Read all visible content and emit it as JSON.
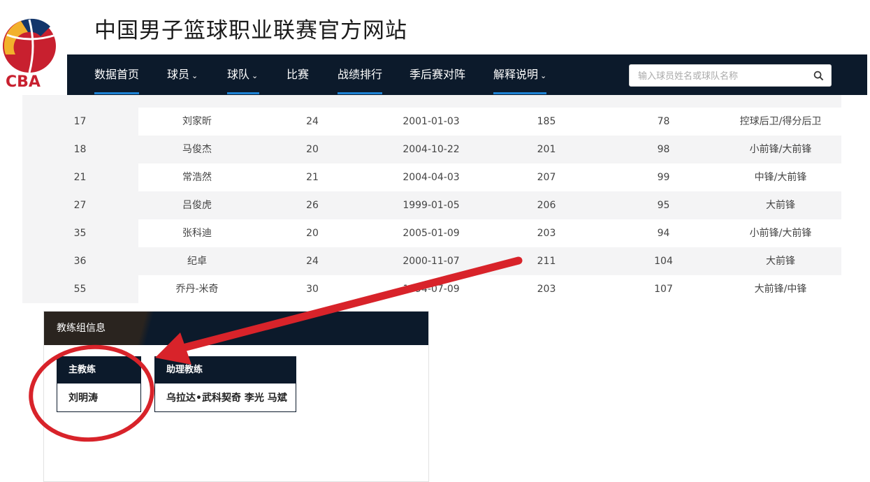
{
  "site": {
    "title": "中国男子篮球职业联赛官方网站",
    "logo_text": "CBA"
  },
  "nav": {
    "items": [
      {
        "label": "数据首页",
        "dropdown": false
      },
      {
        "label": "球员",
        "dropdown": true
      },
      {
        "label": "球队",
        "dropdown": true
      },
      {
        "label": "比赛",
        "dropdown": false
      },
      {
        "label": "战绩排行",
        "dropdown": false
      },
      {
        "label": "季后赛对阵",
        "dropdown": false
      },
      {
        "label": "解释说明",
        "dropdown": true
      }
    ],
    "chevron": "⌄"
  },
  "search": {
    "placeholder": "输入球员姓名或球队名称",
    "icon": "search-icon"
  },
  "roster": {
    "rows": [
      {
        "num": "17",
        "name": "刘家昕",
        "age": "24",
        "birth": "2001-01-03",
        "height": "185",
        "weight": "78",
        "position": "控球后卫/得分后卫"
      },
      {
        "num": "18",
        "name": "马俊杰",
        "age": "20",
        "birth": "2004-10-22",
        "height": "201",
        "weight": "98",
        "position": "小前锋/大前锋"
      },
      {
        "num": "21",
        "name": "常浩然",
        "age": "21",
        "birth": "2004-04-03",
        "height": "207",
        "weight": "99",
        "position": "中锋/大前锋"
      },
      {
        "num": "27",
        "name": "吕俊虎",
        "age": "26",
        "birth": "1999-01-05",
        "height": "206",
        "weight": "95",
        "position": "大前锋"
      },
      {
        "num": "35",
        "name": "张科迪",
        "age": "20",
        "birth": "2005-01-09",
        "height": "203",
        "weight": "94",
        "position": "小前锋/大前锋"
      },
      {
        "num": "36",
        "name": "纪卓",
        "age": "24",
        "birth": "2000-11-07",
        "height": "211",
        "weight": "104",
        "position": "大前锋"
      },
      {
        "num": "55",
        "name": "乔丹-米奇",
        "age": "30",
        "birth": "1994-07-09",
        "height": "203",
        "weight": "107",
        "position": "大前锋/中锋"
      }
    ]
  },
  "coaches": {
    "section_title": "教练组信息",
    "head_coach": {
      "label": "主教练",
      "names": "刘明涛"
    },
    "assistant_coaches": {
      "label": "助理教练",
      "names": "乌拉达•武科契奇 李光 马斌"
    }
  },
  "colors": {
    "navbar": "#0c1a2b",
    "accent_underline": "#1d82d4",
    "annotation_red": "#d8232a"
  }
}
